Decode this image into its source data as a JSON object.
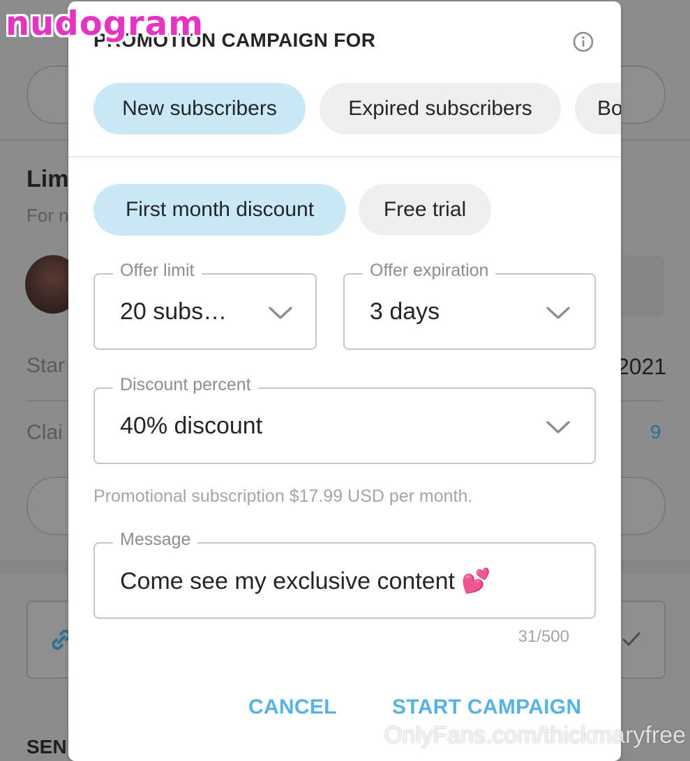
{
  "watermark": {
    "logo": "nudogram",
    "footer": "OnlyFans.com/thickmaryfree"
  },
  "background": {
    "section_title_fragment": "Lim",
    "section_subtitle_fragment": "For n",
    "row1_label_fragment": "Star",
    "row1_value_fragment": "2021",
    "row2_label_fragment": "Clai",
    "row2_value": "9",
    "bottom_label_fragment": "SEN"
  },
  "dialog": {
    "title": "PROMOTION CAMPAIGN FOR",
    "info_icon": "info-circle-icon",
    "audience_tabs": [
      {
        "label": "New subscribers",
        "selected": true
      },
      {
        "label": "Expired subscribers",
        "selected": false
      },
      {
        "label": "Bo",
        "selected": false
      }
    ],
    "offer_types": [
      {
        "label": "First month discount",
        "selected": true
      },
      {
        "label": "Free trial",
        "selected": false
      }
    ],
    "offer_limit": {
      "label": "Offer limit",
      "value": "20 subs…"
    },
    "offer_expiration": {
      "label": "Offer expiration",
      "value": "3 days"
    },
    "discount_percent": {
      "label": "Discount percent",
      "value": "40% discount"
    },
    "hint": "Promotional subscription $17.99 USD per month.",
    "message": {
      "label": "Message",
      "value": "Come see my exclusive content 💕",
      "counter": "31/500"
    },
    "cancel_label": "CANCEL",
    "start_label": "START CAMPAIGN"
  },
  "colors": {
    "accent": "#56b3e3",
    "selected_pill": "#c9e9f8",
    "unselected_pill": "#eeeff1",
    "logo": "#e533c4"
  }
}
